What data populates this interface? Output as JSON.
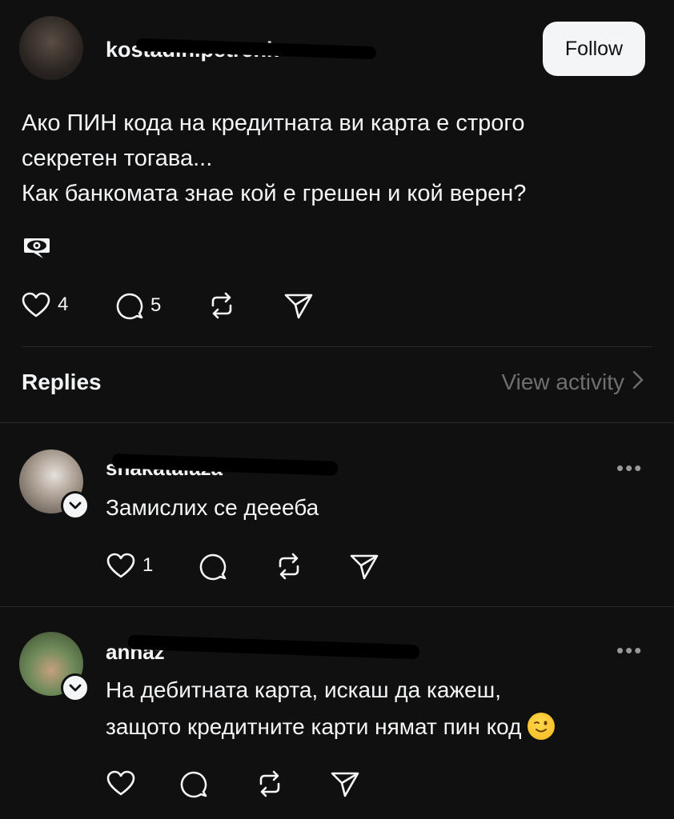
{
  "post": {
    "username_visible": "kostadin.petrenk",
    "follow_label": "Follow",
    "text_lines": [
      "Ако ПИН кода на кредитната ви карта е строго",
      "секретен тогава...",
      "Как банкомата знае кой е грешен и кой верен?"
    ],
    "emoji_icon": "eye-in-speech-bubble",
    "likes": "4",
    "comments": "5"
  },
  "replies_section": {
    "title": "Replies",
    "view_activity_label": "View activity"
  },
  "replies": [
    {
      "username_visible": "shakatalaza",
      "text": "Замислих се деееба",
      "likes": "1",
      "more_label": "•••"
    },
    {
      "username_visible": "annaz",
      "text_lines": [
        "На дебитната карта, искаш да кажеш,",
        "защото кредитните карти нямат пин код"
      ],
      "emoji": "winking-face",
      "more_label": "•••"
    }
  ],
  "colors": {
    "background": "#101010",
    "text": "#f3f5f7",
    "muted": "#6f6f6f",
    "divider": "#2b2b2b"
  }
}
